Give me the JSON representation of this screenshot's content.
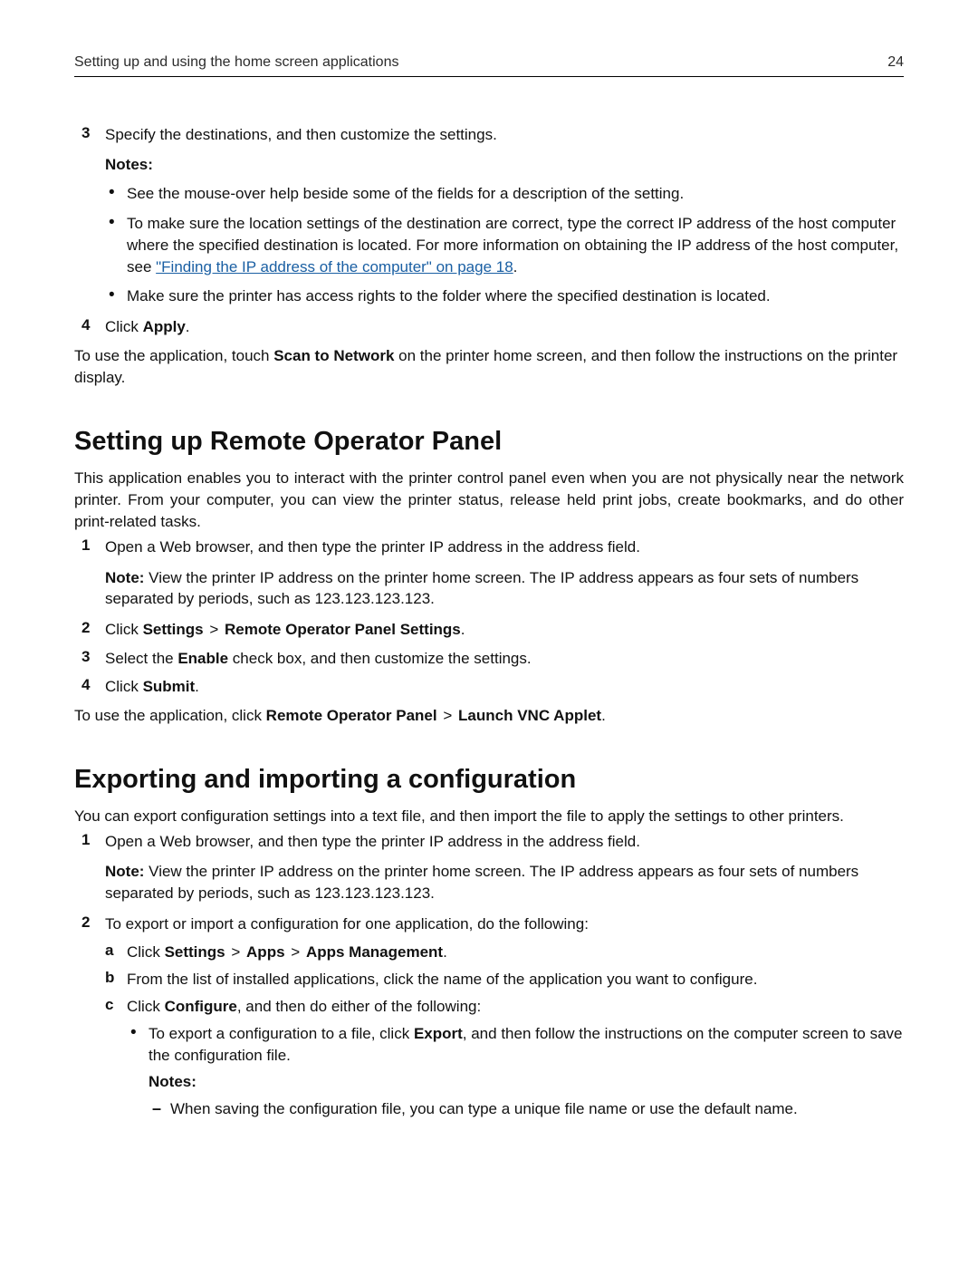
{
  "header": {
    "left": "Setting up and using the home screen applications",
    "right": "24"
  },
  "sectionA": {
    "step3": {
      "marker": "3",
      "text": "Specify the destinations, and then customize the settings."
    },
    "notes_label": "Notes:",
    "bullets": {
      "b0": "See the mouse-over help beside some of the fields for a description of the setting.",
      "b1_pre": "To make sure the location settings of the destination are correct, type the correct IP address of the host computer where the specified destination is located. For more information on obtaining the IP address of the host computer, see ",
      "b1_link": "\"Finding the IP address of the computer\" on page 18",
      "b1_post": ".",
      "b2": "Make sure the printer has access rights to the folder where the specified destination is located."
    },
    "step4": {
      "marker": "4",
      "pre": "Click ",
      "bold": "Apply",
      "post": "."
    },
    "tail_pre": "To use the application, touch ",
    "tail_bold": "Scan to Network",
    "tail_post": " on the printer home screen, and then follow the instructions on the printer display."
  },
  "sectionB": {
    "title": "Setting up Remote Operator Panel",
    "intro": "This application enables you to interact with the printer control panel even when you are not physically near the network printer. From your computer, you can view the printer status, release held print jobs, create bookmarks, and do other print-related tasks.",
    "step1": {
      "marker": "1",
      "text": "Open a Web browser, and then type the printer IP address in the address field."
    },
    "note": {
      "lead": "Note: ",
      "text": "View the printer IP address on the printer home screen. The IP address appears as four sets of numbers separated by periods, such as 123.123.123.123."
    },
    "step2": {
      "marker": "2",
      "pre": "Click ",
      "b1": "Settings",
      "gt": ">",
      "b2": "Remote Operator Panel Settings",
      "post": "."
    },
    "step3": {
      "marker": "3",
      "pre": "Select the ",
      "b1": "Enable",
      "post": " check box, and then customize the settings."
    },
    "step4": {
      "marker": "4",
      "pre": "Click ",
      "b1": "Submit",
      "post": "."
    },
    "tail": {
      "pre": "To use the application, click ",
      "b1": "Remote Operator Panel",
      "gt": ">",
      "b2": "Launch VNC Applet",
      "post": "."
    }
  },
  "sectionC": {
    "title": "Exporting and importing a configuration",
    "intro": "You can export configuration settings into a text file, and then import the file to apply the settings to other printers.",
    "step1": {
      "marker": "1",
      "text": "Open a Web browser, and then type the printer IP address in the address field."
    },
    "note": {
      "lead": "Note: ",
      "text": "View the printer IP address on the printer home screen. The IP address appears as four sets of numbers separated by periods, such as 123.123.123.123."
    },
    "step2": {
      "marker": "2",
      "text": "To export or import a configuration for one application, do the following:"
    },
    "sub": {
      "a": {
        "marker": "a",
        "pre": "Click ",
        "b1": "Settings",
        "gt": ">",
        "b2": "Apps",
        "b3": "Apps Management",
        "post": "."
      },
      "b": {
        "marker": "b",
        "text": "From the list of installed applications, click the name of the application you want to configure."
      },
      "c": {
        "marker": "c",
        "pre": "Click ",
        "b1": "Configure",
        "post": ", and then do either of the following:"
      }
    },
    "inner_bullet": {
      "pre": "To export a configuration to a file, click ",
      "b1": "Export",
      "post": ", and then follow the instructions on the computer screen to save the configuration file."
    },
    "inner_notes_label": "Notes:",
    "dash_bullet": "When saving the configuration file, you can type a unique file name or use the default name."
  }
}
